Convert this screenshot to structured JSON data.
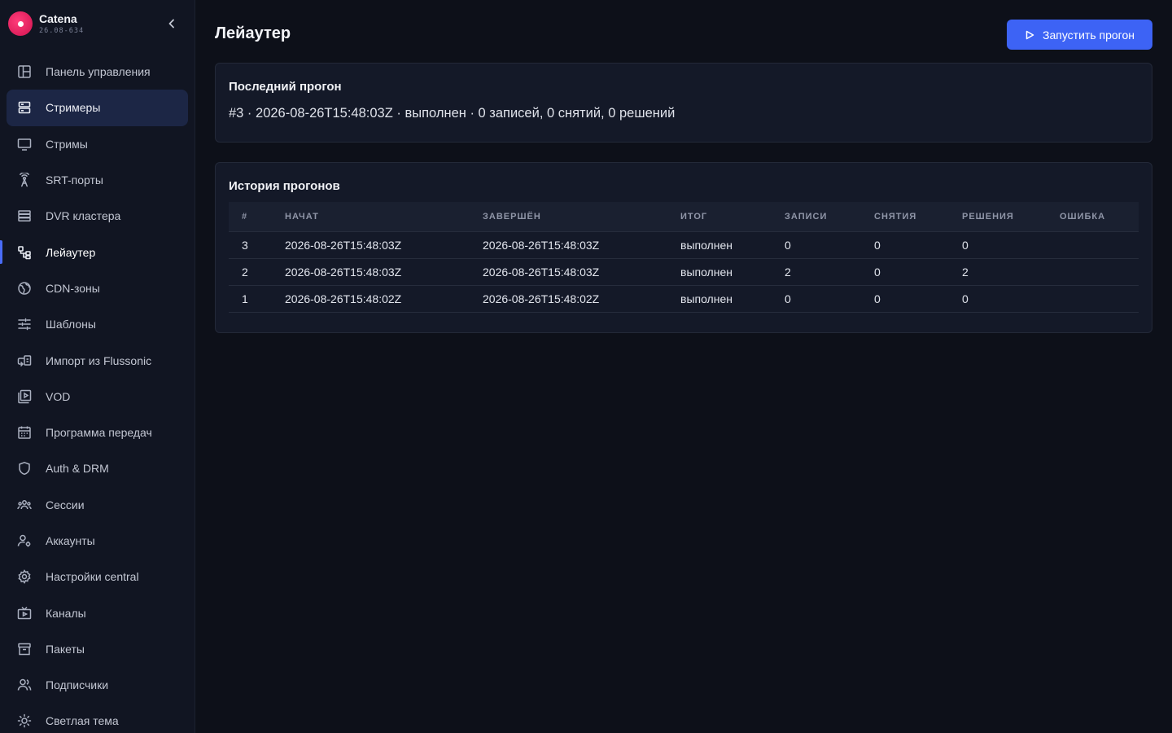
{
  "brand": {
    "name": "Catena",
    "version": "26.08-634"
  },
  "sidebar": {
    "items": [
      {
        "label": "Панель управления",
        "icon": "dashboard-icon"
      },
      {
        "label": "Стримеры",
        "icon": "server-icon"
      },
      {
        "label": "Стримы",
        "icon": "monitor-icon"
      },
      {
        "label": "SRT-порты",
        "icon": "antenna-icon"
      },
      {
        "label": "DVR кластера",
        "icon": "storage-icon"
      },
      {
        "label": "Лейаутер",
        "icon": "layout-icon"
      },
      {
        "label": "CDN-зоны",
        "icon": "globe-icon"
      },
      {
        "label": "Шаблоны",
        "icon": "sliders-icon"
      },
      {
        "label": "Импорт из Flussonic",
        "icon": "import-icon"
      },
      {
        "label": "VOD",
        "icon": "video-library-icon"
      },
      {
        "label": "Программа передач",
        "icon": "calendar-icon"
      },
      {
        "label": "Auth & DRM",
        "icon": "shield-icon"
      },
      {
        "label": "Сессии",
        "icon": "users-group-icon"
      },
      {
        "label": "Аккаунты",
        "icon": "user-gear-icon"
      },
      {
        "label": "Настройки central",
        "icon": "gear-icon"
      },
      {
        "label": "Каналы",
        "icon": "tv-icon"
      },
      {
        "label": "Пакеты",
        "icon": "archive-icon"
      },
      {
        "label": "Подписчики",
        "icon": "subscribers-icon"
      },
      {
        "label": "Светлая тема",
        "icon": "sun-icon"
      }
    ]
  },
  "page": {
    "title": "Лейаутер",
    "run_button_label": "Запустить прогон"
  },
  "last_run": {
    "title": "Последний прогон",
    "summary": "#3 · 2026-08-26T15:48:03Z · выполнен · 0 записей, 0 снятий, 0 решений"
  },
  "history": {
    "title": "История прогонов",
    "columns": [
      "#",
      "НАЧАТ",
      "ЗАВЕРШЁН",
      "ИТОГ",
      "ЗАПИСИ",
      "СНЯТИЯ",
      "РЕШЕНИЯ",
      "ОШИБКА"
    ],
    "rows": [
      [
        "3",
        "2026-08-26T15:48:03Z",
        "2026-08-26T15:48:03Z",
        "выполнен",
        "0",
        "0",
        "0",
        ""
      ],
      [
        "2",
        "2026-08-26T15:48:03Z",
        "2026-08-26T15:48:03Z",
        "выполнен",
        "2",
        "0",
        "2",
        ""
      ],
      [
        "1",
        "2026-08-26T15:48:02Z",
        "2026-08-26T15:48:02Z",
        "выполнен",
        "0",
        "0",
        "0",
        ""
      ]
    ]
  },
  "colors": {
    "accent": "#3d63f5",
    "brand": "#e8175d",
    "background": "#0d1019",
    "sidebar": "#111522",
    "card": "#141928"
  }
}
